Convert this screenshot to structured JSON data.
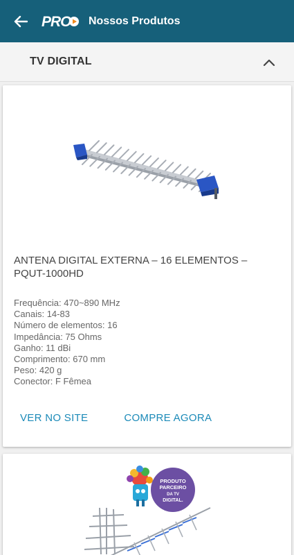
{
  "appbar": {
    "title": "Nossos Produtos",
    "logo_text": "PRO",
    "back_icon": "arrow-left-icon",
    "background": "#16607a"
  },
  "section": {
    "title": "TV DIGITAL",
    "toggle_icon": "chevron-up-icon"
  },
  "products": [
    {
      "name": "ANTENA DIGITAL EXTERNA – 16 ELEMENTOS – PQUT-1000HD",
      "specs": [
        "Frequência: 470~890 MHz",
        "Canais: 14-83",
        "Número de elementos: 16",
        "Impedância: 75 Ohms",
        "Ganho: 11 dBi",
        "Comprimento: 670 mm",
        "Peso: 420 g",
        "Conector: F Fêmea"
      ],
      "actions": {
        "view_site": "VER NO SITE",
        "buy_now": "COMPRE AGORA"
      }
    },
    {
      "badge_text": "PRODUTO PARCEIRO DA TV DIGITAL."
    }
  ],
  "colors": {
    "accent": "#1b8ab8",
    "badge": "#6c4fa3"
  }
}
